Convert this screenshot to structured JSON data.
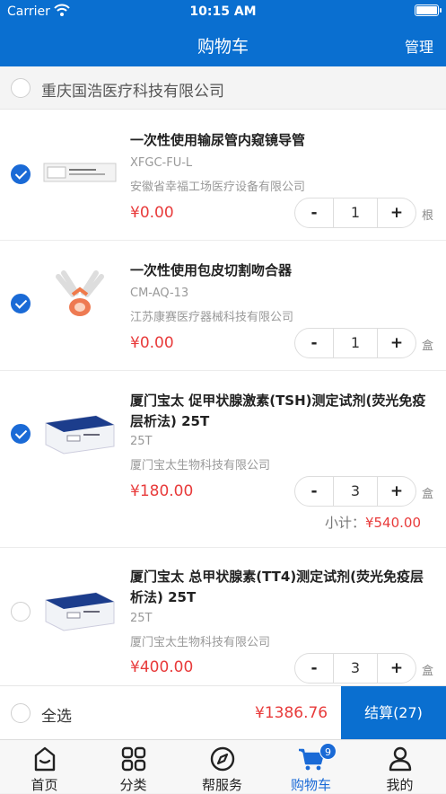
{
  "status_bar": {
    "carrier": "Carrier",
    "time": "10:15 AM"
  },
  "nav": {
    "title": "购物车",
    "manage": "管理"
  },
  "shop": {
    "name": "重庆国浩医疗科技有限公司"
  },
  "items": [
    {
      "name": "一次性使用输尿管内窥镜导管",
      "code": "XFGC-FU-L",
      "maker": "安徽省幸福工场医疗设备有限公司",
      "price": "¥0.00",
      "qty": "1",
      "unit": "根",
      "checked": true,
      "minus": "-",
      "plus": "+"
    },
    {
      "name": "一次性使用包皮切割吻合器",
      "code": "CM-AQ-13",
      "maker": "江苏康赛医疗器械科技有限公司",
      "price": "¥0.00",
      "qty": "1",
      "unit": "盒",
      "checked": true,
      "minus": "-",
      "plus": "+"
    },
    {
      "name": "厦门宝太 促甲状腺激素(TSH)测定试剂(荧光免疫层析法) 25T",
      "code": "25T",
      "maker": "厦门宝太生物科技有限公司",
      "price": "¥180.00",
      "qty": "3",
      "unit": "盒",
      "checked": true,
      "minus": "-",
      "plus": "+",
      "subtotal_label": "小计：",
      "subtotal_value": "¥540.00"
    },
    {
      "name": "厦门宝太 总甲状腺素(TT4)测定试剂(荧光免疫层析法) 25T",
      "code": "25T",
      "maker": "厦门宝太生物科技有限公司",
      "price": "¥400.00",
      "qty": "3",
      "unit": "盒",
      "checked": false,
      "minus": "-",
      "plus": "+"
    }
  ],
  "checkout": {
    "select_all": "全选",
    "total": "¥1386.76",
    "pay_button": "结算(27)"
  },
  "tabs": [
    {
      "label": "首页",
      "icon": "home-icon"
    },
    {
      "label": "分类",
      "icon": "category-grid-icon"
    },
    {
      "label": "帮服务",
      "icon": "compass-icon"
    },
    {
      "label": "购物车",
      "icon": "cart-icon",
      "badge": "9",
      "active": true
    },
    {
      "label": "我的",
      "icon": "user-icon"
    }
  ],
  "colors": {
    "brand": "#0a6fd0",
    "price": "#e83b3b",
    "check": "#1a6ad6"
  }
}
